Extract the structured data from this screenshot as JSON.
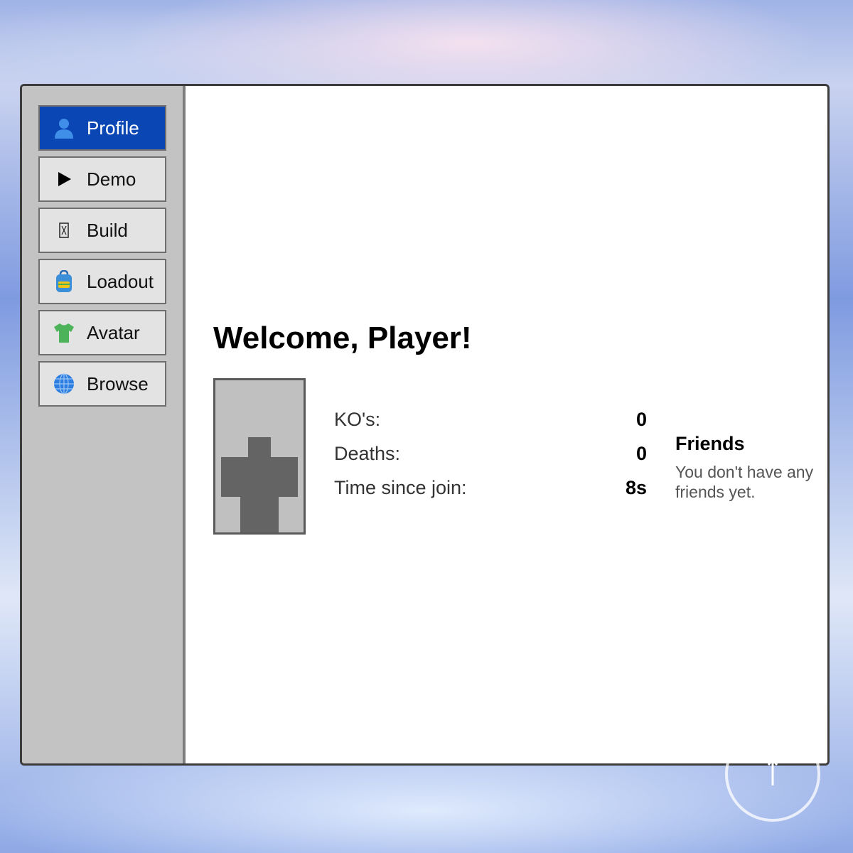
{
  "sidebar": {
    "items": [
      {
        "label": "Profile",
        "icon": "person-icon",
        "active": true
      },
      {
        "label": "Demo",
        "icon": "play-icon",
        "active": false
      },
      {
        "label": "Build",
        "icon": "hammer-icon",
        "active": false
      },
      {
        "label": "Loadout",
        "icon": "backpack-icon",
        "active": false
      },
      {
        "label": "Avatar",
        "icon": "tshirt-icon",
        "active": false
      },
      {
        "label": "Browse",
        "icon": "globe-icon",
        "active": false
      }
    ]
  },
  "profile": {
    "title": "Welcome, Player!",
    "stats": [
      {
        "label": "KO's:",
        "value": "0"
      },
      {
        "label": "Deaths:",
        "value": "0"
      },
      {
        "label": "Time since join:",
        "value": "8s"
      }
    ],
    "friends": {
      "title": "Friends",
      "empty_message": "You don't have any friends yet."
    }
  },
  "colors": {
    "active_nav": "#0a47b5",
    "sidebar_bg": "#c3c3c3",
    "avatar_body": "#646464"
  }
}
